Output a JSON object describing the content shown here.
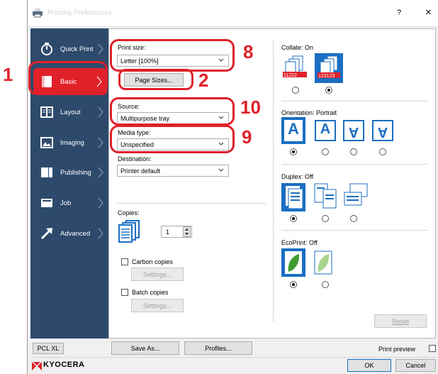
{
  "callouts": [
    "1",
    "2",
    "8",
    "10",
    "9"
  ],
  "titlebar": {
    "title": "Printing Preferences",
    "help": "?",
    "close": "×"
  },
  "sidebar": {
    "items": [
      {
        "label": "Quick Print"
      },
      {
        "label": "Basic"
      },
      {
        "label": "Layout"
      },
      {
        "label": "Imaging"
      },
      {
        "label": "Publishing"
      },
      {
        "label": "Job"
      },
      {
        "label": "Advanced"
      }
    ]
  },
  "basic": {
    "print_size_label": "Print size:",
    "print_size_value": "Letter  [100%]",
    "page_sizes_button": "Page Sizes...",
    "source_label": "Source:",
    "source_value": "Multipurpose tray",
    "media_type_label": "Media type:",
    "media_type_value": "Unspecified",
    "destination_label": "Destination:",
    "destination_value": "Printer default",
    "copies_label": "Copies:",
    "copies_value": "1",
    "carbon_copies_label": "Carbon copies",
    "carbon_settings_button": "Settings...",
    "batch_copies_label": "Batch copies",
    "batch_settings_button": "Settings..."
  },
  "right": {
    "collate_label": "Collate:  On",
    "orientation_label": "Orientation:  Portrait",
    "duplex_label": "Duplex:  Off",
    "ecoprint_label": "EcoPrint:  Off",
    "reset_button": "Reset",
    "collate_off_pages": "11222",
    "collate_on_pages": "123123"
  },
  "bottom": {
    "pcl_xl_button": "PCL XL",
    "save_as_button": "Save As...",
    "profiles_button": "Profiles...",
    "print_preview_label": "Print preview",
    "brand": "KYOCERA",
    "ok_button": "OK",
    "cancel_button": "Cancel"
  },
  "colors": {
    "sidebar": "#2d4a6c",
    "selected": "#e0212a",
    "accent_blue": "#1b6ec2"
  }
}
